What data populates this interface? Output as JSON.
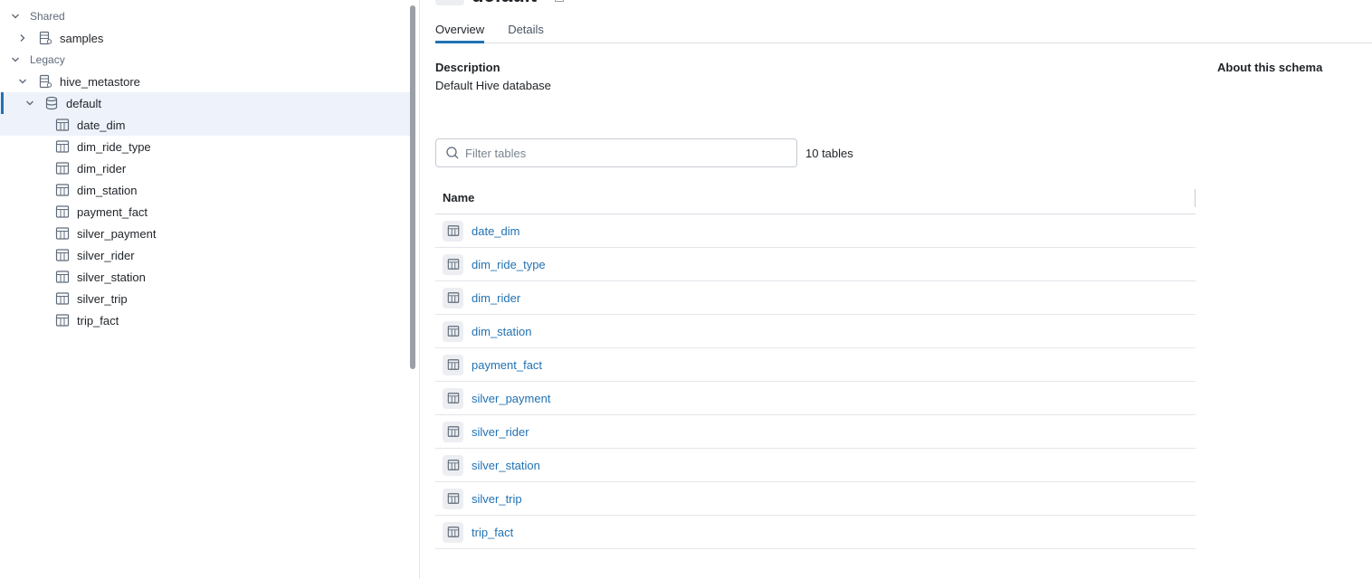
{
  "tree": {
    "sections": {
      "shared": "Shared",
      "legacy": "Legacy"
    },
    "catalogs": {
      "samples": "samples",
      "hive": "hive_metastore"
    },
    "schema": "default",
    "tables": [
      "date_dim",
      "dim_ride_type",
      "dim_rider",
      "dim_station",
      "payment_fact",
      "silver_payment",
      "silver_rider",
      "silver_station",
      "silver_trip",
      "trip_fact"
    ]
  },
  "header": {
    "title": "default"
  },
  "tabs": {
    "overview": "Overview",
    "details": "Details"
  },
  "description": {
    "label": "Description",
    "value": "Default Hive database"
  },
  "about": "About this schema",
  "filter": {
    "placeholder": "Filter tables",
    "count": "10 tables"
  },
  "table": {
    "header": "Name",
    "rows": [
      "date_dim",
      "dim_ride_type",
      "dim_rider",
      "dim_station",
      "payment_fact",
      "silver_payment",
      "silver_rider",
      "silver_station",
      "silver_trip",
      "trip_fact"
    ]
  },
  "colors": {
    "accent": "#2272b4",
    "selected_bg": "#eef3fb"
  },
  "icons": {
    "catalog": "catalog-icon",
    "schema": "database-icon",
    "table": "table-icon",
    "search": "search-icon",
    "chevron": "chevron-icon"
  }
}
